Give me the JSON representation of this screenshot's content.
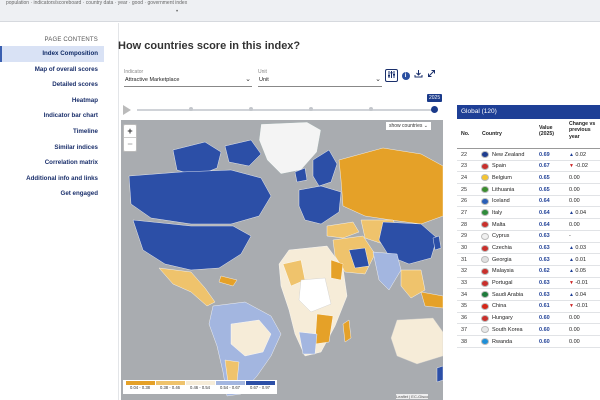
{
  "browser": {
    "url": "population · indicators/scoreboard · country data · year · good · government index"
  },
  "sidebar": {
    "title": "PAGE CONTENTS",
    "items": [
      {
        "label": "Index Composition",
        "active": true
      },
      {
        "label": "Map of overall scores",
        "active": false
      },
      {
        "label": "Detailed scores",
        "active": false
      },
      {
        "label": "Heatmap",
        "active": false
      },
      {
        "label": "Indicator bar chart",
        "active": false
      },
      {
        "label": "Timeline",
        "active": false
      },
      {
        "label": "Similar indices",
        "active": false
      },
      {
        "label": "Correlation matrix",
        "active": false
      },
      {
        "label": "Additional info and links",
        "active": false
      },
      {
        "label": "Get engaged",
        "active": false
      }
    ]
  },
  "main": {
    "title": "How countries score in this index?",
    "indicator_label": "Indicator",
    "indicator_value": "Attractive Marketplace",
    "unit_label": "Unit",
    "unit_value": "Unit",
    "toolbar_icons": [
      "filter-sliders-icon",
      "info-icon",
      "download-icon",
      "expand-icon"
    ],
    "timeline_year": "2025",
    "show_countries_label": "show countries",
    "zoom_in": "+",
    "zoom_out": "−",
    "legend": [
      {
        "label": "0.04 - 0.38",
        "color": "#e5a128"
      },
      {
        "label": "0.38 - 0.46",
        "color": "#efc36c"
      },
      {
        "label": "0.46 - 0.54",
        "color": "#f6ecd8"
      },
      {
        "label": "0.54 - 0.67",
        "color": "#a3b6e0"
      },
      {
        "label": "0.67 - 0.97",
        "color": "#2c4fa7"
      }
    ],
    "attribution": "Leaflet | EC-Gisco"
  },
  "table": {
    "title": "Global (120)",
    "col_no": "No.",
    "col_country": "Country",
    "col_value": "Value (2025)",
    "col_change": "Change vs previous year",
    "rows": [
      {
        "no": "22",
        "flag": "#1f3d8f",
        "country": "New Zealand",
        "value": "0.69",
        "dir": "up",
        "change": "0.02"
      },
      {
        "no": "23",
        "flag": "#c9302c",
        "country": "Spain",
        "value": "0.67",
        "dir": "down",
        "change": "-0.02"
      },
      {
        "no": "24",
        "flag": "#f4c430",
        "country": "Belgium",
        "value": "0.65",
        "dir": "none",
        "change": "0.00"
      },
      {
        "no": "25",
        "flag": "#3c8d2f",
        "country": "Lithuania",
        "value": "0.65",
        "dir": "none",
        "change": "0.00"
      },
      {
        "no": "26",
        "flag": "#2a5fb8",
        "country": "Iceland",
        "value": "0.64",
        "dir": "none",
        "change": "0.00"
      },
      {
        "no": "27",
        "flag": "#2e8b3a",
        "country": "Italy",
        "value": "0.64",
        "dir": "up",
        "change": "0.04"
      },
      {
        "no": "28",
        "flag": "#c9302c",
        "country": "Malta",
        "value": "0.64",
        "dir": "none",
        "change": "0.00"
      },
      {
        "no": "29",
        "flag": "#f0f0f0",
        "country": "Cyprus",
        "value": "0.63",
        "dir": "none",
        "change": "-"
      },
      {
        "no": "30",
        "flag": "#c9302c",
        "country": "Czechia",
        "value": "0.63",
        "dir": "up",
        "change": "0.03"
      },
      {
        "no": "31",
        "flag": "#e0e0e0",
        "country": "Georgia",
        "value": "0.63",
        "dir": "up",
        "change": "0.01"
      },
      {
        "no": "32",
        "flag": "#c9302c",
        "country": "Malaysia",
        "value": "0.62",
        "dir": "up",
        "change": "0.05"
      },
      {
        "no": "33",
        "flag": "#c9302c",
        "country": "Portugal",
        "value": "0.63",
        "dir": "down",
        "change": "-0.01"
      },
      {
        "no": "34",
        "flag": "#1e7a3a",
        "country": "Saudi Arabia",
        "value": "0.63",
        "dir": "up",
        "change": "0.04"
      },
      {
        "no": "35",
        "flag": "#d62718",
        "country": "China",
        "value": "0.61",
        "dir": "down",
        "change": "-0.01"
      },
      {
        "no": "36",
        "flag": "#c9302c",
        "country": "Hungary",
        "value": "0.60",
        "dir": "none",
        "change": "0.00"
      },
      {
        "no": "37",
        "flag": "#e8e8e8",
        "country": "South Korea",
        "value": "0.60",
        "dir": "none",
        "change": "0.00"
      },
      {
        "no": "38",
        "flag": "#1e8fd8",
        "country": "Rwanda",
        "value": "0.60",
        "dir": "none",
        "change": "0.00"
      }
    ]
  },
  "colors": {
    "accent": "#1e3f96",
    "map_ocean": "#a9acb0",
    "up": "#1e3f96",
    "down": "#cc2222"
  }
}
